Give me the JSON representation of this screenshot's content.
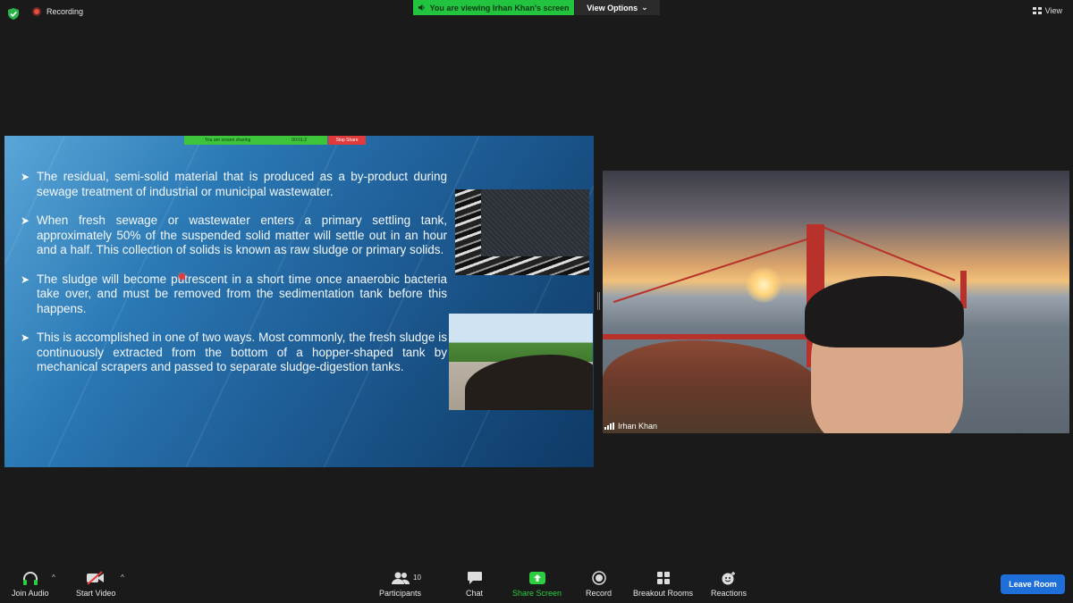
{
  "top": {
    "recording_label": "Recording",
    "viewing_label": "You are viewing Irhan Khan's screen",
    "view_options_label": "View Options",
    "view_label": "View"
  },
  "slide": {
    "share_bar_label": "You are screen sharing",
    "share_timer": "00:01:2",
    "stop_share_label": "Stop Share",
    "bullets": [
      "The residual, semi-solid material that is produced as a by-product during sewage treatment of industrial or municipal wastewater.",
      "When fresh sewage or wastewater enters a primary settling tank, approximately 50% of the suspended solid matter will settle out in an hour and a half. This collection of solids is known as raw sludge or primary solids.",
      "The sludge will become putrescent in a short time once anaerobic bacteria take over, and must be removed from the sedimentation tank before this happens.",
      "This is accomplished in one of two ways. Most commonly, the fresh sludge is continuously extracted from the bottom of a hopper-shaped tank by mechanical scrapers and passed to separate sludge-digestion tanks."
    ]
  },
  "video": {
    "participant_name": "Irhan Khan"
  },
  "toolbar": {
    "join_audio": "Join Audio",
    "start_video": "Start Video",
    "participants": "Participants",
    "participants_count": "10",
    "chat": "Chat",
    "share_screen": "Share Screen",
    "record": "Record",
    "breakout_rooms": "Breakout Rooms",
    "reactions": "Reactions",
    "leave_room": "Leave Room"
  },
  "colors": {
    "green_banner": "#22c33f",
    "stop_red": "#e13a3a",
    "leave_blue": "#1e6fd9",
    "share_green": "#2ecc40"
  }
}
